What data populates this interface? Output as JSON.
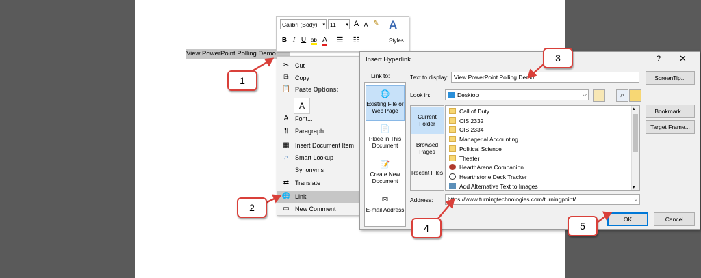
{
  "document": {
    "selected_text": "View PowerPoint Polling Demo"
  },
  "mini_toolbar": {
    "font_name": "Calibri (Body)",
    "font_size": "11",
    "grow_font": "A",
    "shrink_font": "A",
    "bold": "B",
    "italic": "I",
    "underline": "U",
    "styles_label": "Styles"
  },
  "context_menu": {
    "items": [
      {
        "label": "Cut",
        "icon": "scissors-icon"
      },
      {
        "label": "Copy",
        "icon": "copy-icon"
      },
      {
        "label": "Paste Options:",
        "icon": "clipboard-icon"
      },
      {
        "label": "Font...",
        "icon": "font-icon"
      },
      {
        "label": "Paragraph...",
        "icon": "paragraph-icon"
      },
      {
        "label": "Insert Document Item",
        "icon": "document-item-icon"
      },
      {
        "label": "Smart Lookup",
        "icon": "search-icon"
      },
      {
        "label": "Synonyms",
        "icon": ""
      },
      {
        "label": "Translate",
        "icon": "translate-icon"
      },
      {
        "label": "Link",
        "icon": "link-icon"
      },
      {
        "label": "New Comment",
        "icon": "comment-icon"
      }
    ]
  },
  "dialog": {
    "title": "Insert Hyperlink",
    "help": "?",
    "close": "✕",
    "link_to_label": "Link to:",
    "link_to": [
      {
        "label": "Existing File or Web Page",
        "selected": true
      },
      {
        "label": "Place in This Document",
        "selected": false
      },
      {
        "label": "Create New Document",
        "selected": false
      },
      {
        "label": "E-mail Address",
        "selected": false
      }
    ],
    "text_to_display_label": "Text to display:",
    "text_to_display_value": "View PowerPoint Polling Demo",
    "screentip_button": "ScreenTip...",
    "look_in_label": "Look in:",
    "look_in_value": "Desktop",
    "side_nav": [
      {
        "label": "Current Folder",
        "selected": true
      },
      {
        "label": "Browsed Pages",
        "selected": false
      },
      {
        "label": "Recent Files",
        "selected": false
      }
    ],
    "files": [
      {
        "name": "Call of Duty",
        "type": "folder"
      },
      {
        "name": "CIS 2332",
        "type": "folder"
      },
      {
        "name": "CIS 2334",
        "type": "folder"
      },
      {
        "name": "Managerial Accounting",
        "type": "folder"
      },
      {
        "name": "Political Science",
        "type": "folder"
      },
      {
        "name": "Theater",
        "type": "folder"
      },
      {
        "name": "HearthArena Companion",
        "type": "app"
      },
      {
        "name": "Hearthstone Deck Tracker",
        "type": "app"
      },
      {
        "name": "Add Alternative Text to Images",
        "type": "image"
      }
    ],
    "bookmark_button": "Bookmark...",
    "target_frame_button": "Target Frame...",
    "address_label": "Address:",
    "address_value": "https://www.turningtechnologies.com/turningpoint/",
    "ok_button": "OK",
    "cancel_button": "Cancel"
  },
  "callouts": [
    "1",
    "2",
    "3",
    "4",
    "5"
  ],
  "colors": {
    "callout_border": "#d9403a",
    "selection_blue": "#c7e1f9",
    "folder_yellow": "#f7d774"
  }
}
